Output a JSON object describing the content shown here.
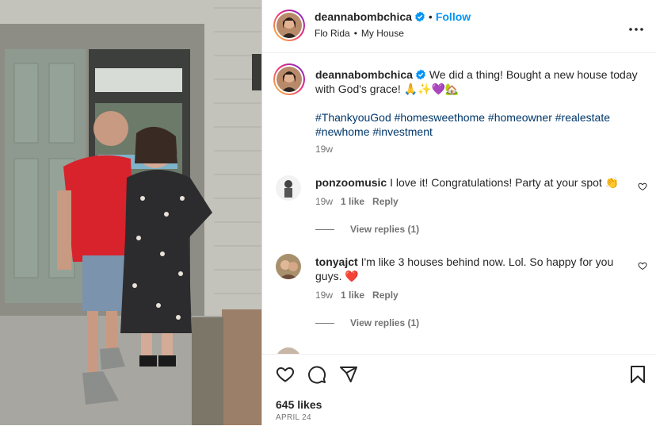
{
  "post": {
    "username": "deannabombchica",
    "follow_label": "Follow",
    "separator": "•",
    "audio": "Flo Rida",
    "audio_sep": "•",
    "track": "My House",
    "more_label": "•••"
  },
  "caption": {
    "username": "deannabombchica",
    "text": "We did a thing! Bought a new house today with God's grace! 🙏✨💜🏡",
    "hashtags": [
      "#ThankyouGod",
      "#homesweethome",
      "#homeowner",
      "#realestate",
      "#newhome",
      "#investment"
    ],
    "time": "19w"
  },
  "comments": [
    {
      "username": "ponzoomusic",
      "text": "I love it! Congratulations! Party at your spot 👏",
      "time": "19w",
      "likes": "1 like",
      "reply_label": "Reply",
      "view_replies": "View replies (1)"
    },
    {
      "username": "tonyajct",
      "text": "I'm like 3 houses behind now. Lol. So happy for you guys. ❤️",
      "time": "19w",
      "likes": "1 like",
      "reply_label": "Reply",
      "view_replies": "View replies (1)"
    }
  ],
  "footer": {
    "likes": "645 likes",
    "date": "APRIL 24"
  },
  "icons": {
    "like": "heart-icon",
    "comment": "comment-icon",
    "share": "share-icon",
    "save": "bookmark-icon",
    "verified": "verified-badge-icon",
    "comment_like": "heart-small-icon"
  },
  "colors": {
    "link": "#0095f6",
    "hashtag": "#00376b",
    "muted": "#737373",
    "text": "#262626"
  }
}
